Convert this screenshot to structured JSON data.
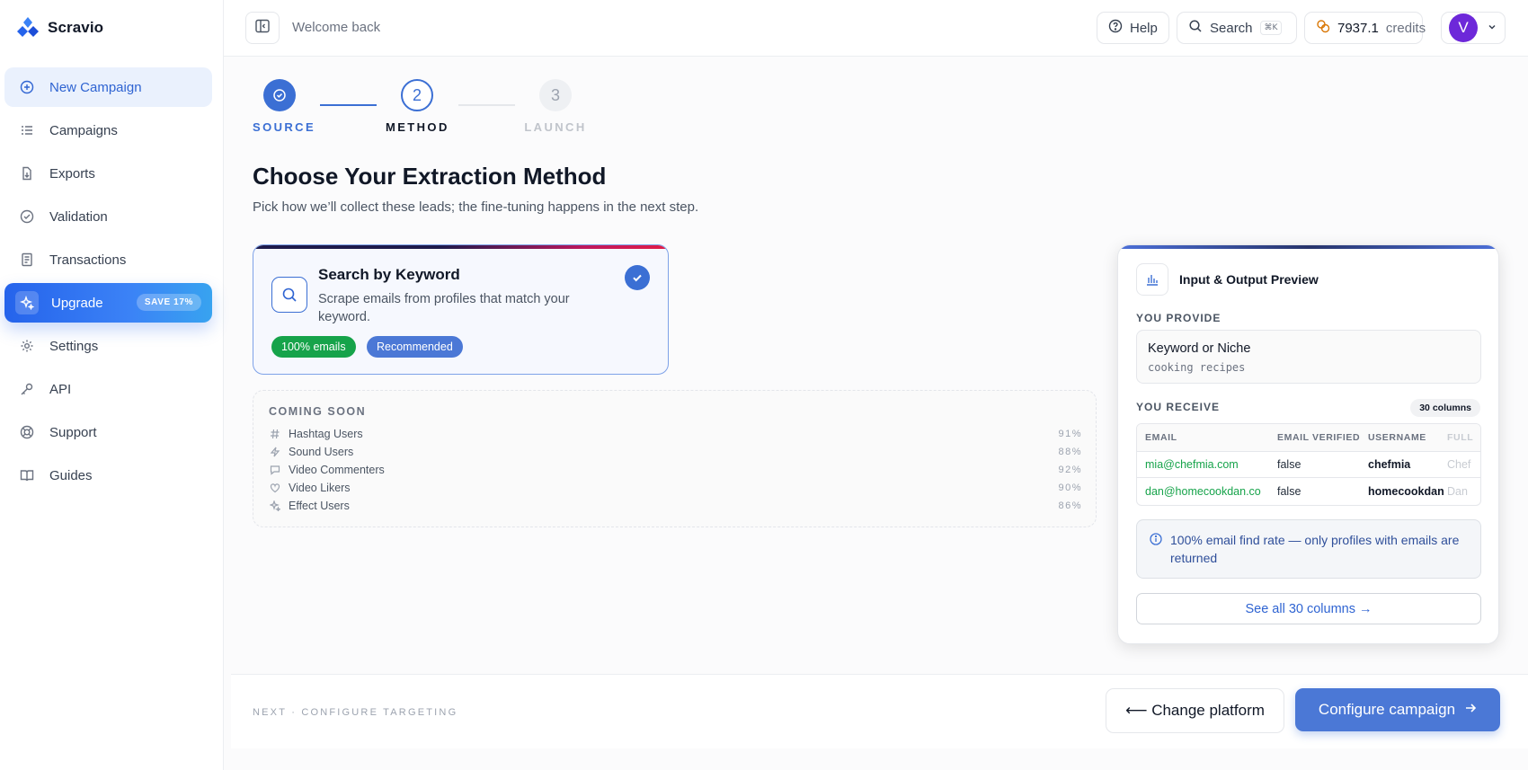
{
  "brand": {
    "name": "Scravio"
  },
  "sidebar": {
    "items": [
      {
        "label": "New Campaign",
        "icon": "plus-circle-icon"
      },
      {
        "label": "Campaigns",
        "icon": "list-icon"
      },
      {
        "label": "Exports",
        "icon": "file-export-icon"
      },
      {
        "label": "Validation",
        "icon": "check-circle-icon"
      },
      {
        "label": "Transactions",
        "icon": "receipt-icon"
      },
      {
        "label": "Upgrade",
        "icon": "sparkle-icon",
        "badge": "SAVE 17%"
      },
      {
        "label": "Settings",
        "icon": "gear-icon"
      },
      {
        "label": "API",
        "icon": "key-icon"
      },
      {
        "label": "Support",
        "icon": "lifebuoy-icon"
      },
      {
        "label": "Guides",
        "icon": "book-icon"
      }
    ]
  },
  "header": {
    "welcome": "Welcome back",
    "help_label": "Help",
    "search_label": "Search",
    "search_shortcut": "⌘K",
    "credits_value": "7937.1",
    "credits_label": "credits",
    "avatar_initial": "V"
  },
  "stepper": {
    "steps": [
      {
        "label": "SOURCE",
        "state": "done"
      },
      {
        "label": "METHOD",
        "number": "2",
        "state": "current"
      },
      {
        "label": "LAUNCH",
        "number": "3",
        "state": "upcoming"
      }
    ]
  },
  "main": {
    "title": "Choose Your Extraction Method",
    "subtitle": "Pick how we’ll collect these leads; the fine-tuning happens in the next step."
  },
  "method_card": {
    "title": "Search by Keyword",
    "description": "Scrape emails from profiles that match your keyword.",
    "badges": [
      "100% emails",
      "Recommended"
    ],
    "selected": true
  },
  "coming_soon": {
    "title": "COMING SOON",
    "items": [
      {
        "label": "Hashtag Users",
        "pct": "91%",
        "icon": "hash-icon"
      },
      {
        "label": "Sound Users",
        "pct": "88%",
        "icon": "bolt-icon"
      },
      {
        "label": "Video Commenters",
        "pct": "92%",
        "icon": "comment-icon"
      },
      {
        "label": "Video Likers",
        "pct": "90%",
        "icon": "heart-icon"
      },
      {
        "label": "Effect Users",
        "pct": "86%",
        "icon": "sparkle-icon"
      }
    ]
  },
  "preview": {
    "title": "Input & Output Preview",
    "you_provide": "YOU PROVIDE",
    "input_key": "Keyword or Niche",
    "input_value": "cooking recipes",
    "you_receive": "YOU RECEIVE",
    "columns_badge": "30 columns",
    "table": {
      "headers": [
        "EMAIL",
        "EMAIL VERIFIED",
        "USERNAME",
        "FULL"
      ],
      "rows": [
        [
          "mia@chefmia.com",
          "false",
          "chefmia",
          "Chef"
        ],
        [
          "dan@homecookdan.co",
          "false",
          "homecookdan",
          "Dan"
        ]
      ]
    },
    "info": "100% email find rate — only profiles with emails are returned",
    "see_all": "See all 30 columns →"
  },
  "footer": {
    "next_label": "NEXT · CONFIGURE TARGETING",
    "change_platform": "⟵ Change platform",
    "configure": "Configure campaign"
  },
  "colors": {
    "accent": "#3b6fd4",
    "success": "#16a34a",
    "upgrade_gradient_start": "#2563eb"
  }
}
